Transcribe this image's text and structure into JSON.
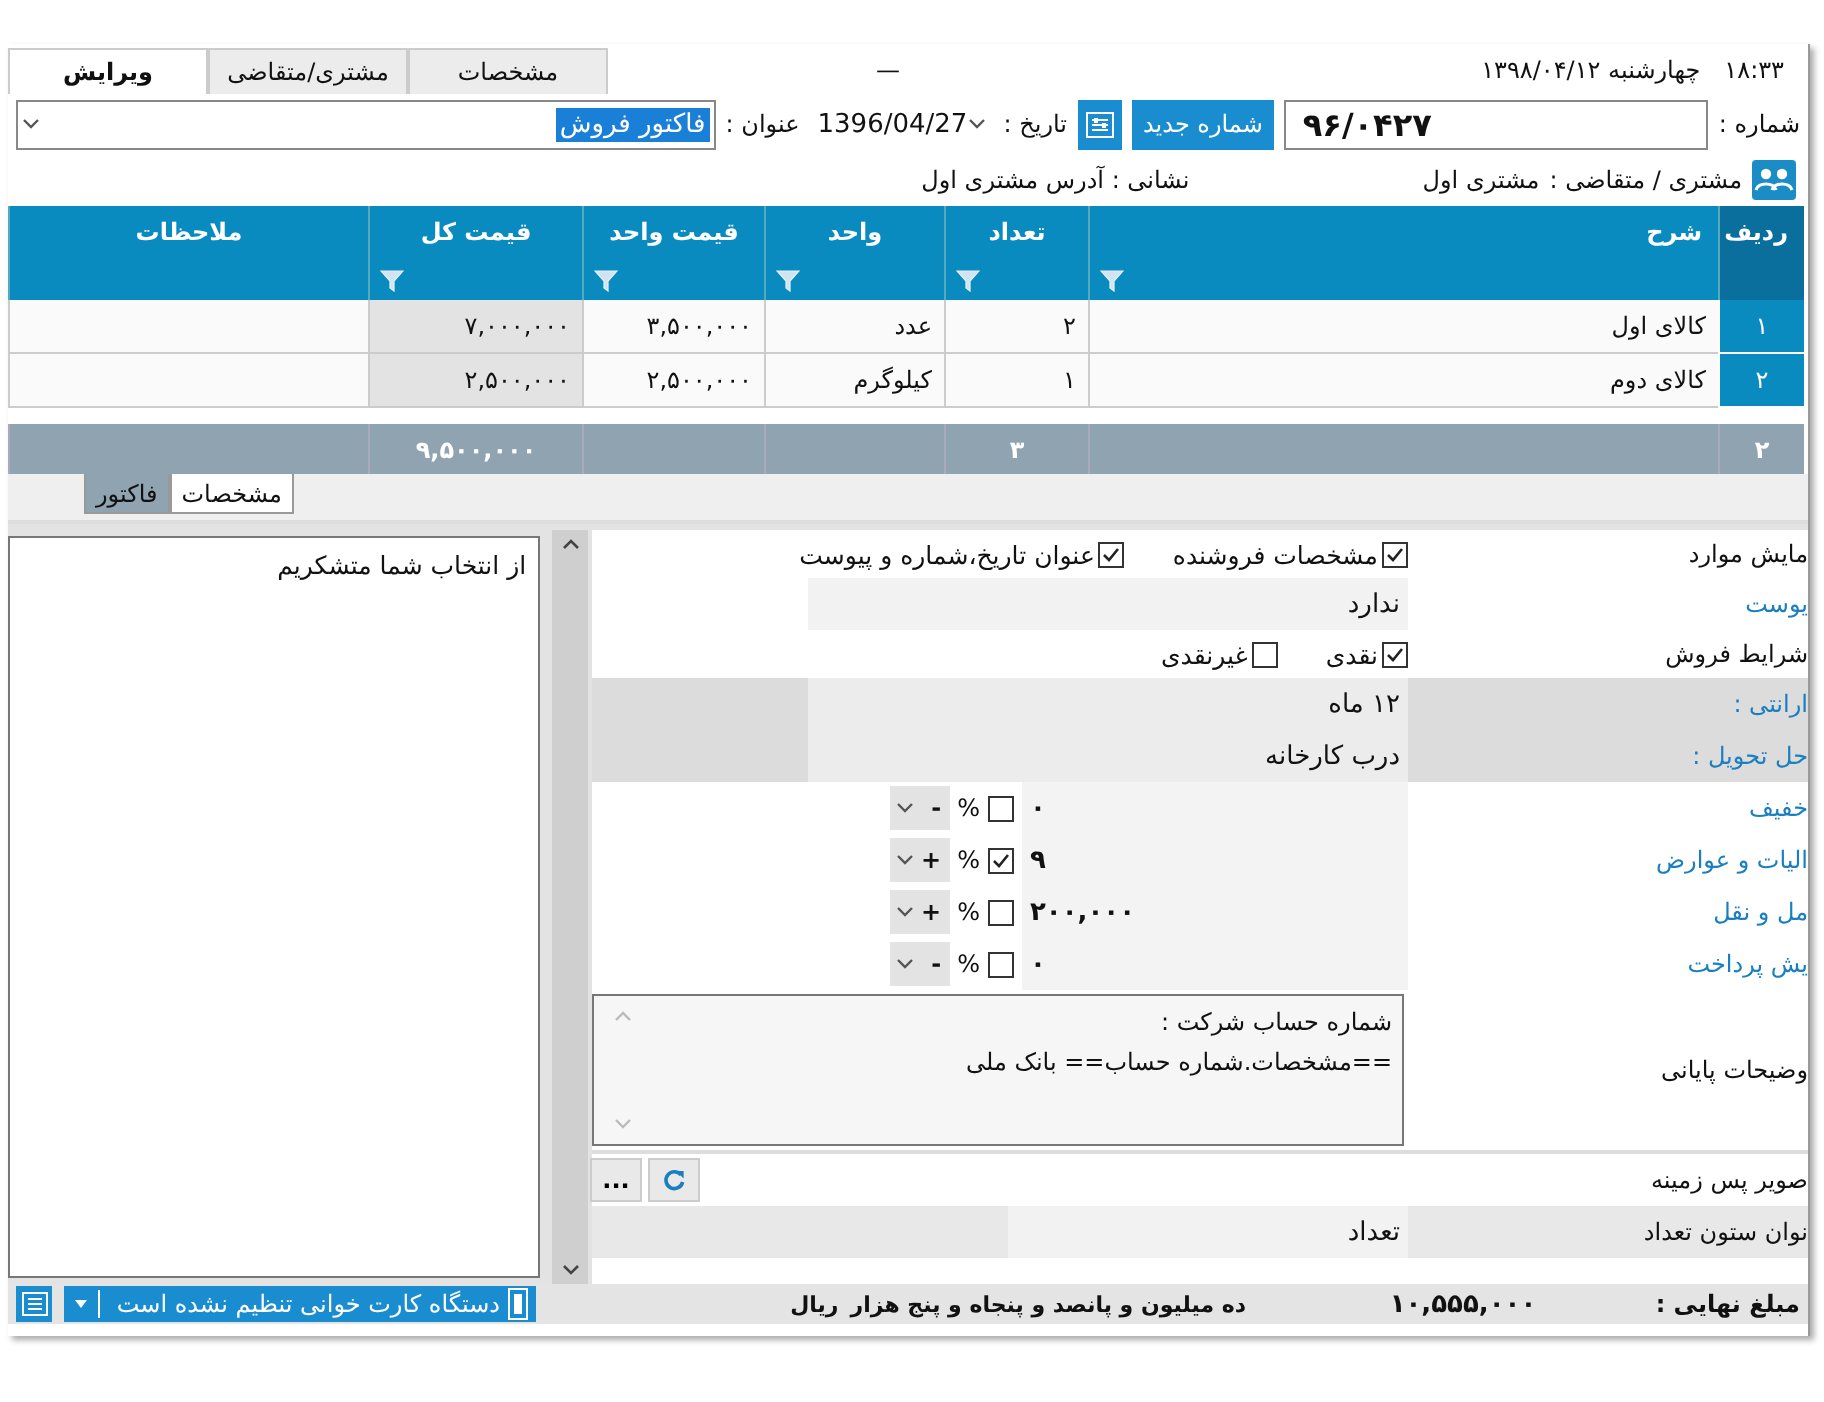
{
  "top_bar": {
    "tabs": [
      {
        "label": "مشخصات",
        "selected": false
      },
      {
        "label": "مشتری/متقاضی",
        "selected": false
      },
      {
        "label": "ویرایش",
        "selected": true
      }
    ],
    "minimize": "—",
    "time": "۱۸:۳۳",
    "date": "چهارشنبه  ۱۳۹۸/۰۴/۱۲"
  },
  "header_form": {
    "number_label": "شماره :",
    "number": "۹۶/۰۴۲۷",
    "new_number_button": "شماره جدید",
    "date_label": "تاریخ :",
    "date": "1396/04/27",
    "title_label": "عنوان :",
    "title": {
      "value": "فاکتور فروش",
      "highlighted": true
    },
    "customer_label": "مشتری / متقاضی :",
    "customer": "مشتری اول",
    "address": "نشانی : آدرس مشتری اول"
  },
  "table": {
    "columns": [
      {
        "label": "ردیف",
        "filter": false
      },
      {
        "label": "شرح",
        "filter": true
      },
      {
        "label": "تعداد",
        "filter": true
      },
      {
        "label": "واحد",
        "filter": true
      },
      {
        "label": "قیمت واحد",
        "filter": true
      },
      {
        "label": "قیمت کل",
        "filter": true
      },
      {
        "label": "ملاحظات",
        "filter": false
      }
    ],
    "rows": [
      {
        "row": "۱",
        "description": "کالای اول",
        "quantity": "۲",
        "unit": "عدد",
        "unit_price": "۳,۵۰۰,۰۰۰",
        "total": "۷,۰۰۰,۰۰۰"
      },
      {
        "row": "۲",
        "description": "کالای دوم",
        "quantity": "۱",
        "unit": "کیلوگرم",
        "unit_price": "۲,۵۰۰,۰۰۰",
        "total": "۲,۵۰۰,۰۰۰"
      }
    ],
    "totals": {
      "row": "۲",
      "quantity": "۳",
      "total": "۹,۵۰۰,۰۰۰"
    }
  },
  "bottom_tabs": [
    {
      "label": "مشخصات",
      "selected": false
    },
    {
      "label": "فاکتور",
      "selected": true
    }
  ],
  "notes": "از انتخاب شما متشکریم",
  "properties": [
    {
      "kind": "checks",
      "label": "مایش موارد",
      "link": false,
      "options": [
        {
          "label": "مشخصات فروشنده",
          "checked": true
        },
        {
          "label": "عنوان تاریخ،شماره و پیوست",
          "checked": true
        }
      ]
    },
    {
      "kind": "text",
      "label": "یوست",
      "link": true,
      "value": "ندارد"
    },
    {
      "kind": "checks",
      "label": "شرایط فروش",
      "link": false,
      "options": [
        {
          "label": "نقدی",
          "checked": true
        },
        {
          "label": "غیرنقدی",
          "checked": false
        }
      ]
    },
    {
      "kind": "info",
      "label": "ارانتی :",
      "link": true,
      "value": "۱۲ ماه"
    },
    {
      "kind": "info",
      "label": "حل تحویل :",
      "link": true,
      "value": "درب کارخانه"
    },
    {
      "kind": "amount",
      "label": "خفیف",
      "link": true,
      "value": "۰",
      "checked": false,
      "percent": "%",
      "sign": "-"
    },
    {
      "kind": "amount",
      "label": "الیات و عوارض",
      "link": true,
      "value": "۹",
      "checked": true,
      "percent": "%",
      "sign": "+"
    },
    {
      "kind": "amount",
      "label": "مل و نقل",
      "link": true,
      "value": "۲۰۰,۰۰۰",
      "checked": false,
      "percent": "%",
      "sign": "+"
    },
    {
      "kind": "amount",
      "label": "یش پرداخت",
      "link": true,
      "value": "۰",
      "checked": false,
      "percent": "%",
      "sign": "-"
    },
    {
      "kind": "memo",
      "label": "وضیحات پایانی",
      "link": false,
      "lines": [
        "شماره حساب شرکت :",
        "==مشخصات.شماره حساب== بانک ملی"
      ]
    },
    {
      "kind": "buttons",
      "label": "صویر پس زمینه",
      "link": false,
      "button": "..."
    },
    {
      "kind": "field",
      "label": "نوان ستون تعداد",
      "link": false,
      "value": "تعداد"
    }
  ],
  "footer": {
    "label": "مبلغ نهایی :",
    "amount": "۱۰,۵۵۵,۰۰۰",
    "words": "ده میلیون و پانصد و پنجاه و پنج هزار",
    "currency": "ریال",
    "card_reader": "دستگاه کارت خوانی تنظیم نشده است"
  }
}
